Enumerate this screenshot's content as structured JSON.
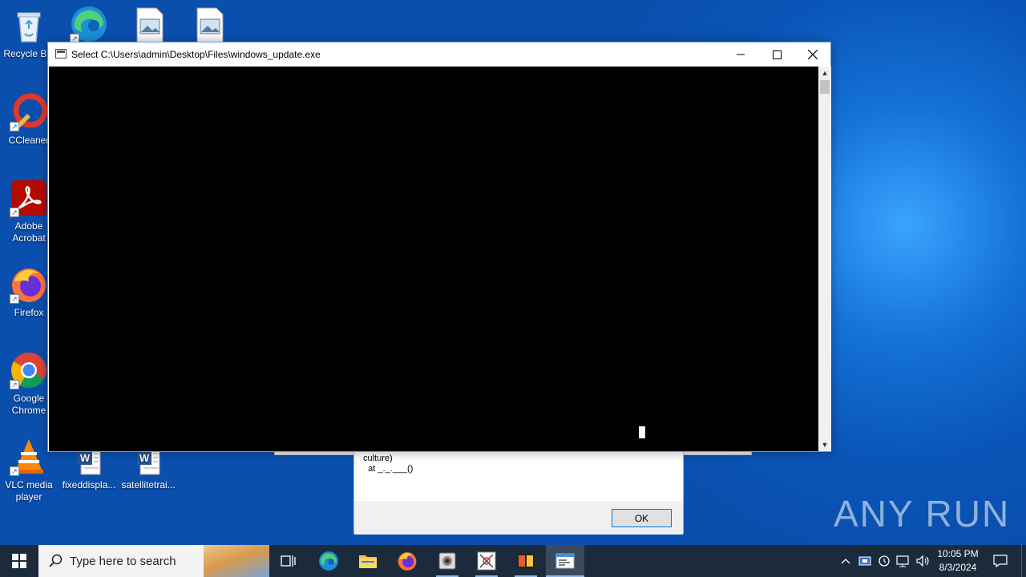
{
  "desktop": {
    "icons": [
      {
        "label": "Recycle Bin"
      },
      {
        "label": ""
      },
      {
        "label": ""
      },
      {
        "label": ""
      },
      {
        "label": "CCleaner"
      },
      {
        "label": "Adobe Acrobat"
      },
      {
        "label": "Firefox"
      },
      {
        "label": "Google Chrome"
      },
      {
        "label": "VLC media player"
      },
      {
        "label": "fixeddispla..."
      },
      {
        "label": "satellitetrai..."
      }
    ]
  },
  "background_dialog": {
    "message": "culture)\n  at _._.___()",
    "ok_label": "OK"
  },
  "console_window": {
    "title": "Select C:\\Users\\admin\\Desktop\\Files\\windows_update.exe"
  },
  "watermark": {
    "text": "ANY RUN"
  },
  "taskbar": {
    "search_placeholder": "Type here to search",
    "apps": [
      {
        "icon": "task-view-icon"
      },
      {
        "icon": "edge-icon"
      },
      {
        "icon": "file-explorer-icon"
      },
      {
        "icon": "firefox-icon"
      },
      {
        "icon": "app-icon-1"
      },
      {
        "icon": "app-icon-2"
      },
      {
        "icon": "app-icon-3"
      },
      {
        "icon": "console-app-icon"
      }
    ],
    "clock": {
      "time": "10:05 PM",
      "date": "8/3/2024"
    }
  }
}
